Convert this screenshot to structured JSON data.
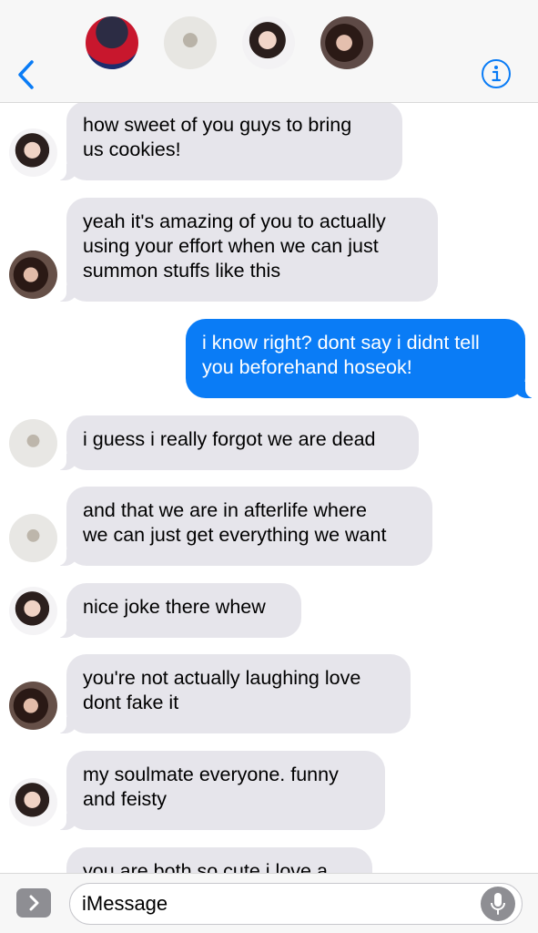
{
  "header": {
    "back_icon": "chevron-left-icon",
    "info_icon": "info-circle-icon",
    "accent_color": "#0a7cf6"
  },
  "messages": [
    {
      "sender": "them",
      "avatar": "girl-white",
      "text": "how sweet of you guys to bring\nus cookies!"
    },
    {
      "sender": "them",
      "avatar": "girl-dark",
      "text": "yeah it's amazing of you to actually\nusing your effort when we can just\nsummon stuffs like this"
    },
    {
      "sender": "me",
      "text": "i know right? dont say i didnt tell\nyou beforehand hoseok!"
    },
    {
      "sender": "them",
      "avatar": "boy",
      "text": "i guess i really forgot we are dead"
    },
    {
      "sender": "them",
      "avatar": "boy",
      "text": "and that we are in afterlife where\nwe can just get everything we want"
    },
    {
      "sender": "them",
      "avatar": "girl-white",
      "text": "nice joke there whew"
    },
    {
      "sender": "them",
      "avatar": "girl-dark",
      "text": "you're not actually laughing love\ndont fake it"
    },
    {
      "sender": "them",
      "avatar": "girl-white",
      "text": "my soulmate everyone. funny\nand feisty"
    },
    {
      "sender": "them",
      "text": "you are both so cute i love a"
    }
  ],
  "composer": {
    "placeholder": "iMessage",
    "apps_icon": "chevron-right-icon",
    "mic_icon": "microphone-icon"
  },
  "colors": {
    "incoming_bubble": "#e6e5eb",
    "outgoing_bubble": "#0a7cf6"
  }
}
